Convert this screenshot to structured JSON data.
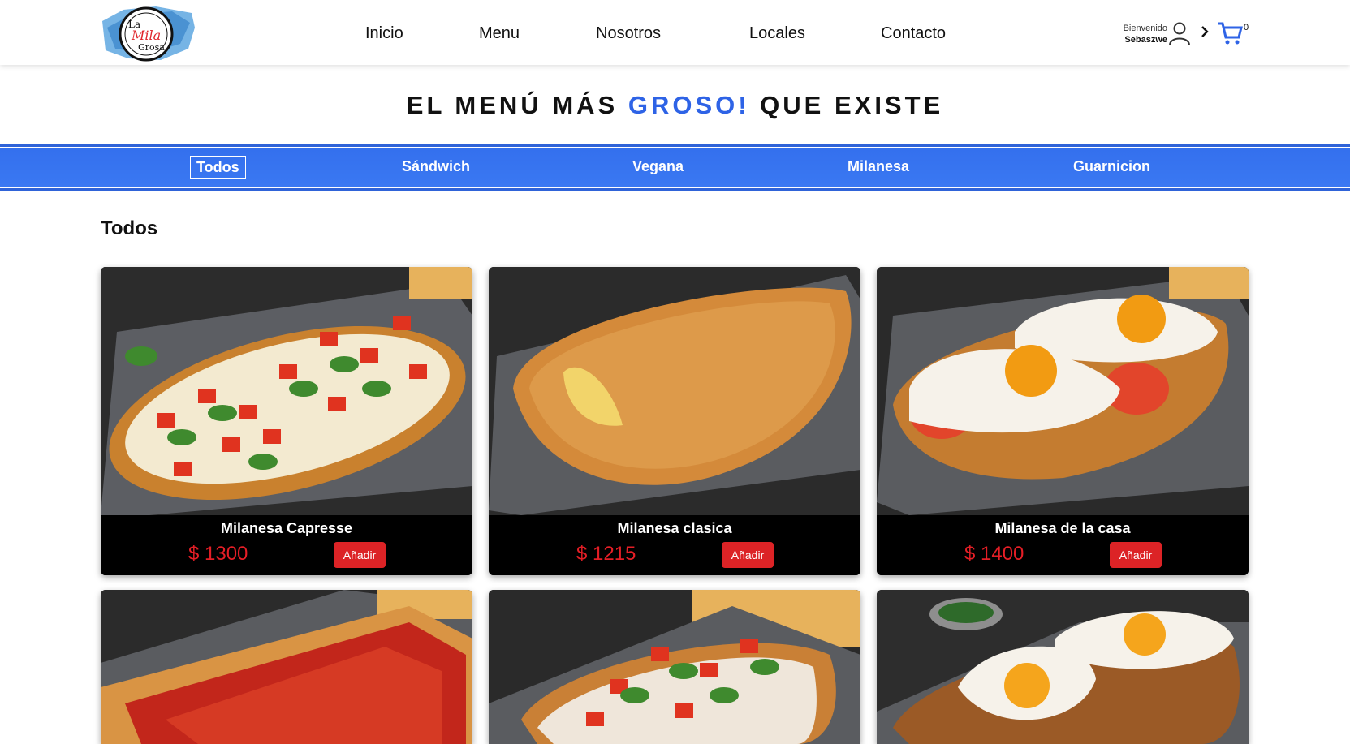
{
  "brand": {
    "logo_line1": "La",
    "logo_line2": "Mila",
    "logo_line3": "Grosa"
  },
  "nav": [
    {
      "label": "Inicio"
    },
    {
      "label": "Menu"
    },
    {
      "label": "Nosotros"
    },
    {
      "label": "Locales"
    },
    {
      "label": "Contacto"
    }
  ],
  "user": {
    "greeting": "Bienvenido",
    "name": "Sebaszwe",
    "cart_count": "0"
  },
  "hero": {
    "before": "EL MENÚ MÁS ",
    "accent": "GROSO!",
    "after": " QUE EXISTE"
  },
  "categories": [
    {
      "label": "Todos",
      "active": true
    },
    {
      "label": "Sándwich"
    },
    {
      "label": "Vegana"
    },
    {
      "label": "Milanesa"
    },
    {
      "label": "Guarnicion"
    }
  ],
  "section_title": "Todos",
  "products": [
    {
      "name": "Milanesa Capresse",
      "price": "$ 1300",
      "button": "Añadir"
    },
    {
      "name": "Milanesa clasica",
      "price": "$ 1215",
      "button": "Añadir"
    },
    {
      "name": "Milanesa de la casa",
      "price": "$ 1400",
      "button": "Añadir"
    },
    {
      "name": "",
      "price": "",
      "button": ""
    },
    {
      "name": "",
      "price": "",
      "button": ""
    },
    {
      "name": "",
      "price": "",
      "button": ""
    }
  ],
  "colors": {
    "accent_blue": "#2e63e6",
    "price_red": "#e41e26",
    "button_red": "#dc2326"
  }
}
